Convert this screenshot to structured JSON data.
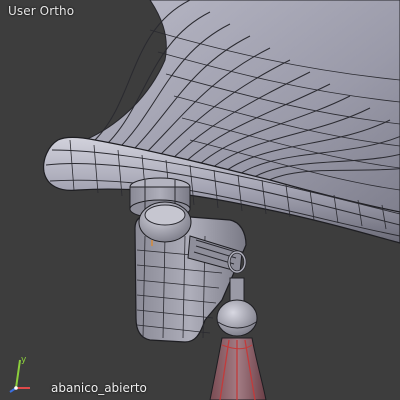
{
  "viewport": {
    "view_label": "User Ortho",
    "object_name": "abanico_abierto",
    "background_color": "#3d3d3d",
    "axes": [
      {
        "name": "y",
        "label": "y",
        "color": "#8ccf3c"
      },
      {
        "name": "x",
        "label": "",
        "color": "#e04a4a"
      },
      {
        "name": "z",
        "label": "",
        "color": "#3b6fe0"
      }
    ],
    "mesh_colors": {
      "surface": "#a9a9b8",
      "surface_dark": "#6e6e7a",
      "wire": "#1e1e22",
      "handle_red": "#c23b3b"
    }
  }
}
